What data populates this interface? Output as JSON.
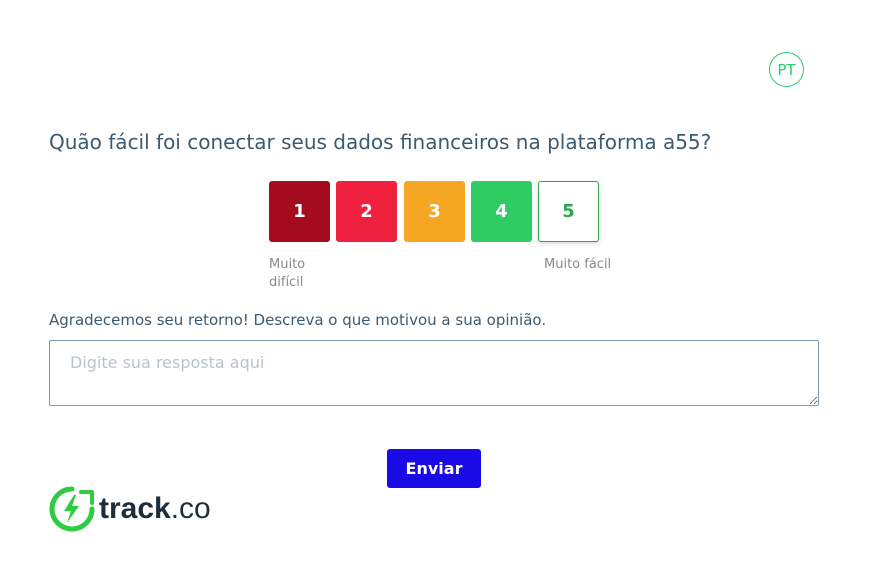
{
  "language_button": "PT",
  "question": "Quão fácil foi conectar seus dados financeiros na plataforma a55?",
  "rating": {
    "scores": [
      "1",
      "2",
      "3",
      "4",
      "5"
    ],
    "selected": "5",
    "low_label": "Muito difícil",
    "high_label": "Muito fácil"
  },
  "feedback": {
    "prompt": "Agradecemos seu retorno! Descreva o que motivou a sua opinião.",
    "placeholder": "Digite sua resposta aqui",
    "value": ""
  },
  "submit_label": "Enviar",
  "logo": {
    "brand": "track",
    "suffix": ".co"
  },
  "colors": {
    "score_1": "#a50b1e",
    "score_2": "#f0213f",
    "score_3": "#f5a623",
    "score_4": "#2ecc63",
    "score_5_outline": "#2ea84f",
    "submit_button": "#1a0ae6",
    "text": "#3d5a73",
    "logo_green": "#2ecc40"
  }
}
